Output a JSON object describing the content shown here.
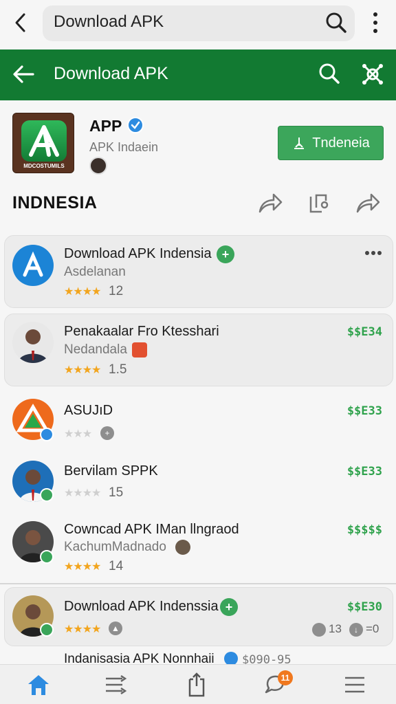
{
  "browser": {
    "url_text": "Download APK"
  },
  "header": {
    "title": "Download APK"
  },
  "app": {
    "name": "APP",
    "subtitle": "APK Indaein",
    "icon_caption": "MDCOSTUMILS",
    "install_label": "Tndeneia"
  },
  "section": {
    "title": "INDNESIA"
  },
  "list": [
    {
      "title": "Download APK Indensia",
      "sub": "Asdelanan",
      "rating": "12",
      "stars": 3.5
    },
    {
      "title": "Penakaalar Fro Ktesshari",
      "sub": "Nedandala",
      "rating": "1.5",
      "stars": 3.5,
      "price": "$$E34"
    },
    {
      "title": "ASUJıD",
      "price": "$$E33",
      "stars": 0
    },
    {
      "title": "Bervilam SPPK",
      "rating": "15",
      "stars": 0,
      "price": "$$E33"
    },
    {
      "title": "Cowncad APK IMan llngraod",
      "sub": "KachumMadnado",
      "rating": "14",
      "stars": 3.5,
      "price": "$$$$$"
    },
    {
      "title": "Download APK Indenssia",
      "stars": 3.5,
      "price": "$$E30",
      "stat1": "13",
      "stat2": "=0"
    },
    {
      "title": "Indanisasia APK Nonnhaii",
      "price": "$090-95"
    }
  ],
  "nav": {
    "badge_count": "11"
  },
  "colors": {
    "header_green": "#127a32",
    "install_green": "#3ca65b",
    "price_green": "#2fa24c",
    "star": "#f2a51e",
    "verified_blue": "#2d8be0"
  }
}
